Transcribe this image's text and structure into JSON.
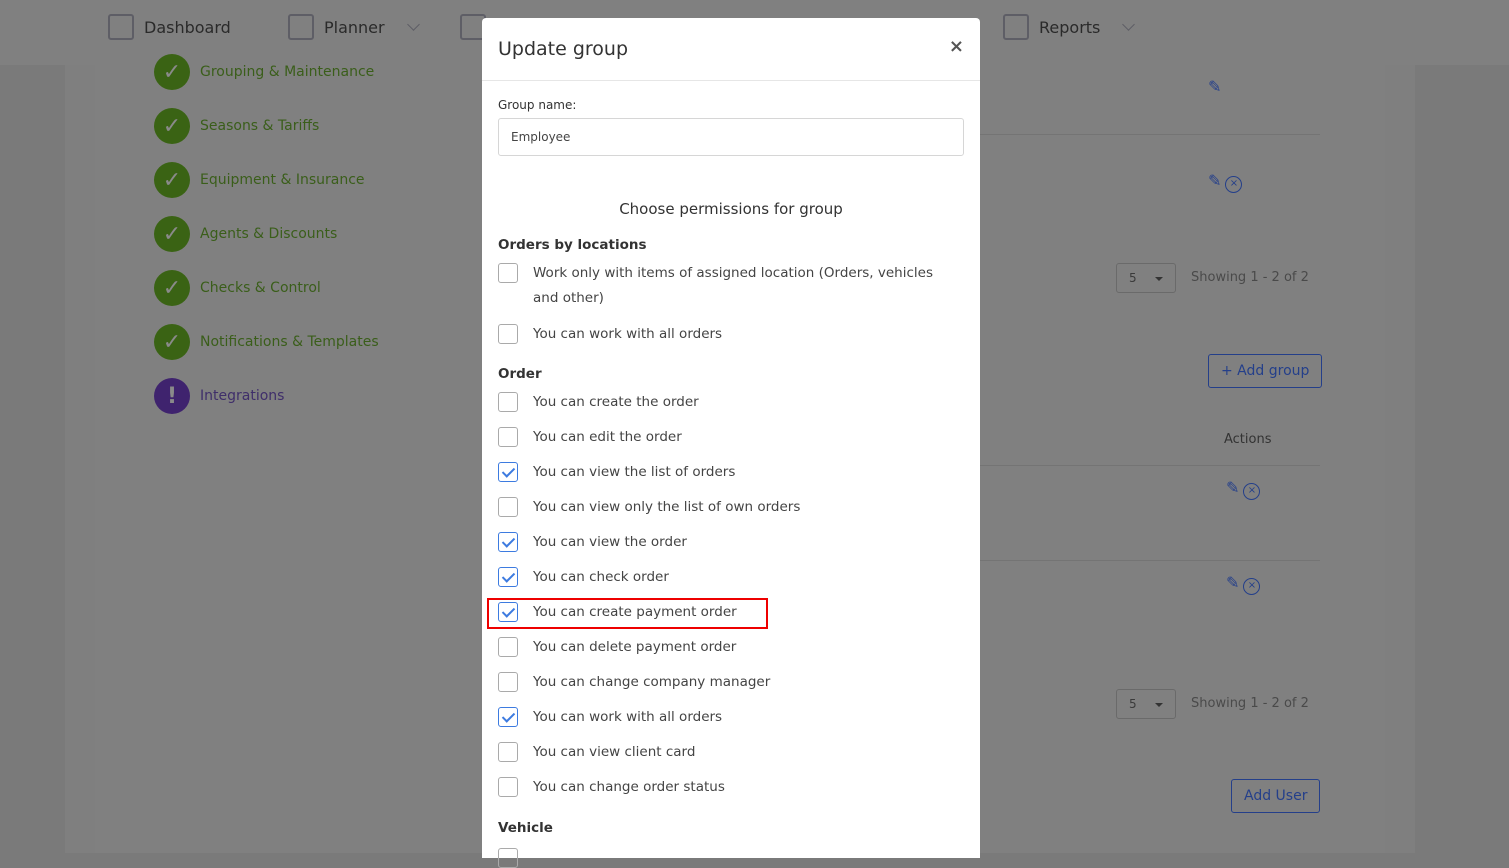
{
  "nav": [
    {
      "label": "Dashboard",
      "icon": "dashboard-icon"
    },
    {
      "label": "Planner",
      "icon": "planner-icon"
    },
    {
      "label": "Reports",
      "icon": "reports-icon"
    }
  ],
  "steps": [
    {
      "label": "Grouping & Maintenance",
      "status": "done"
    },
    {
      "label": "Seasons & Tariffs",
      "status": "done"
    },
    {
      "label": "Equipment & Insurance",
      "status": "done"
    },
    {
      "label": "Agents & Discounts",
      "status": "done"
    },
    {
      "label": "Checks & Control",
      "status": "done"
    },
    {
      "label": "Notifications & Templates",
      "status": "done"
    },
    {
      "label": "Integrations",
      "status": "warning"
    }
  ],
  "groups_table": {
    "page_size": "5",
    "showing": "Showing 1 - 2 of 2",
    "add_button": "+ Add group"
  },
  "users_table": {
    "actions_header": "Actions",
    "page_size": "5",
    "showing": "Showing 1 - 2 of 2",
    "add_button": "Add User"
  },
  "modal": {
    "title": "Update group",
    "close": "×",
    "group_name_label": "Group name:",
    "group_name_value": "Employee",
    "choose": "Choose permissions for group",
    "sections": [
      {
        "title": "Orders by locations",
        "items": [
          {
            "label": "Work only with items of assigned location (Orders, vehicles and other)",
            "checked": false
          },
          {
            "label": "You can work with all orders",
            "checked": false
          }
        ]
      },
      {
        "title": "Order",
        "items": [
          {
            "label": "You can create the order",
            "checked": false
          },
          {
            "label": "You can edit the order",
            "checked": false
          },
          {
            "label": "You can view the list of orders",
            "checked": true
          },
          {
            "label": "You can view only the list of own orders",
            "checked": false
          },
          {
            "label": "You can view the order",
            "checked": true
          },
          {
            "label": "You can check order",
            "checked": true
          },
          {
            "label": "You can create payment order",
            "checked": true,
            "highlighted": true
          },
          {
            "label": "You can delete payment order",
            "checked": false
          },
          {
            "label": "You can change company manager",
            "checked": false
          },
          {
            "label": "You can work with all orders",
            "checked": true
          },
          {
            "label": "You can view client card",
            "checked": false
          },
          {
            "label": "You can change order status",
            "checked": false
          }
        ]
      },
      {
        "title": "Vehicle",
        "items": [
          {
            "label": "",
            "checked": false
          }
        ]
      }
    ]
  },
  "colors": {
    "accent": "#3d7be0",
    "highlight": "#e00000",
    "success": "#3a6314",
    "warning": "#3f236e"
  }
}
